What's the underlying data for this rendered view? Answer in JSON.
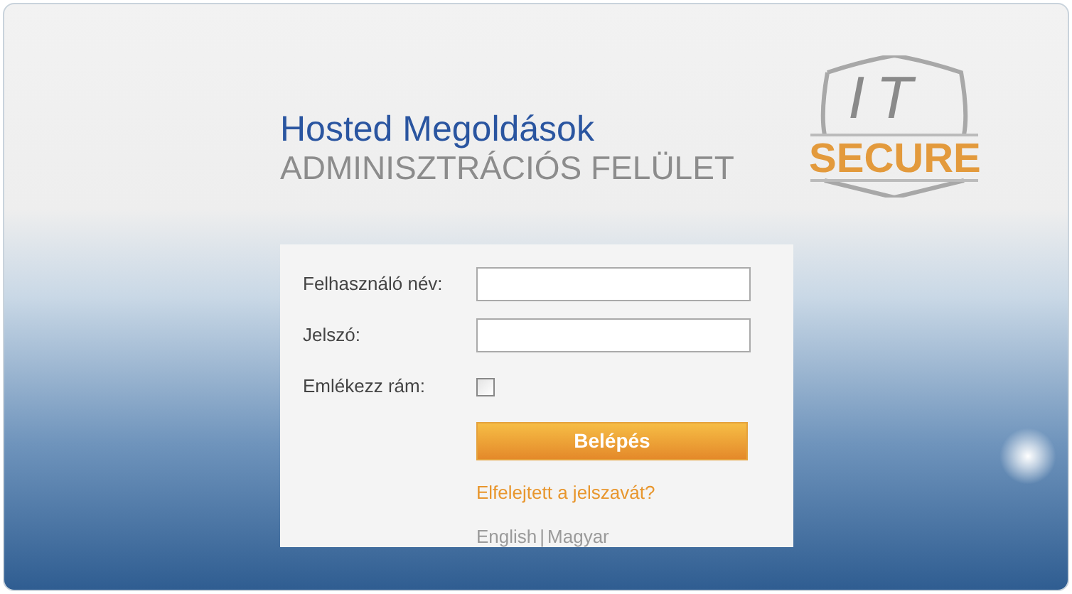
{
  "header": {
    "title": "Hosted Megoldások",
    "subtitle": "ADMINISZTRÁCIÓS FELÜLET"
  },
  "logo": {
    "top": "IT",
    "bottom": "SECURE"
  },
  "form": {
    "fields": [
      {
        "label": "Felhasználó név:",
        "kind": "text"
      },
      {
        "label": "Jelszó:",
        "kind": "password"
      },
      {
        "label": "Emlékezz rám:",
        "kind": "checkbox",
        "checked": false
      }
    ],
    "submit": "Belépés",
    "forgot_link": "Elfelejtett a jelszavát?",
    "languages": [
      {
        "label": "English"
      },
      {
        "label": "Magyar"
      }
    ],
    "language_separator": "|"
  }
}
